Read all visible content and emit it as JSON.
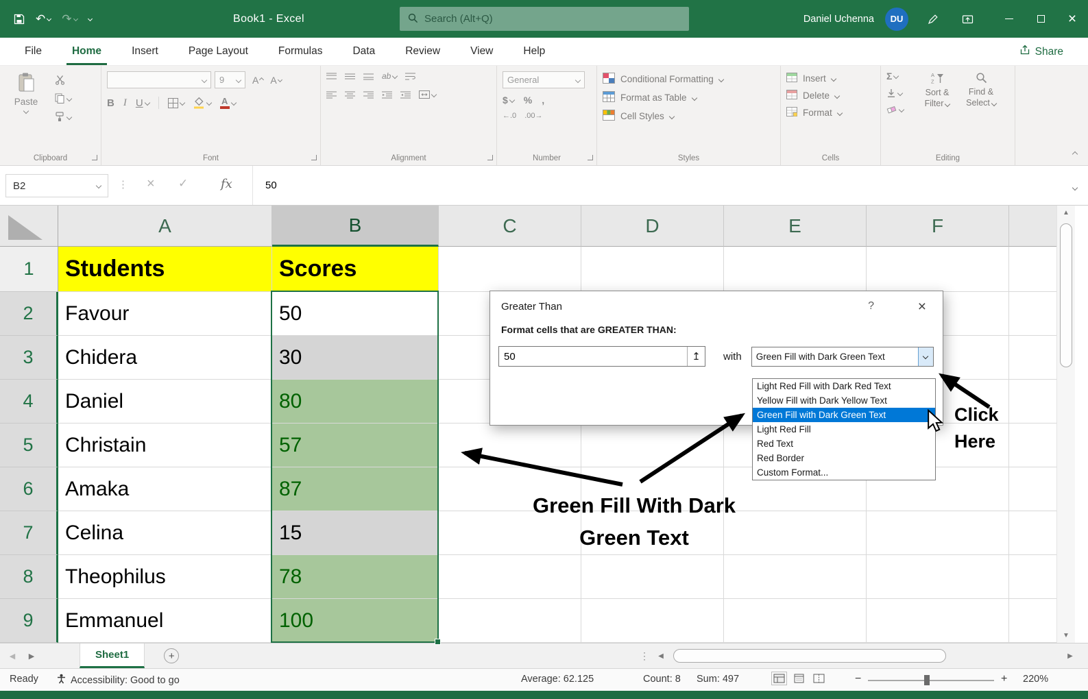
{
  "titlebar": {
    "title": "Book1 - Excel",
    "search_placeholder": "Search (Alt+Q)",
    "user_name": "Daniel Uchenna",
    "user_initials": "DU"
  },
  "menu": {
    "tabs": [
      "File",
      "Home",
      "Insert",
      "Page Layout",
      "Formulas",
      "Data",
      "Review",
      "View",
      "Help"
    ],
    "active_tab": "Home",
    "share_label": "Share"
  },
  "ribbon": {
    "clipboard": {
      "label": "Clipboard",
      "paste": "Paste"
    },
    "font": {
      "label": "Font",
      "size": "9",
      "bold": "B",
      "italic": "I",
      "underline": "U"
    },
    "alignment": {
      "label": "Alignment",
      "orientation": "ab"
    },
    "number": {
      "label": "Number",
      "format": "General",
      "currency": "$",
      "percent": "%",
      "comma": ",",
      "increase_decimal": "←.0",
      "decrease_decimal": ".00→"
    },
    "styles": {
      "label": "Styles",
      "conditional_formatting": "Conditional Formatting",
      "format_as_table": "Format as Table",
      "cell_styles": "Cell Styles"
    },
    "cells": {
      "label": "Cells",
      "insert": "Insert",
      "delete": "Delete",
      "format": "Format"
    },
    "editing": {
      "label": "Editing",
      "autosum": "Σ",
      "sort_line1": "Sort &",
      "sort_line2": "Filter",
      "find_line1": "Find &",
      "find_line2": "Select"
    }
  },
  "formula_bar": {
    "name_box": "B2",
    "fx": "fx",
    "value": "50"
  },
  "grid": {
    "column_headers": [
      "A",
      "B",
      "C",
      "D",
      "E",
      "F"
    ],
    "selected_range_column": "B",
    "rows": [
      {
        "num": "1",
        "student": "Students",
        "score": "Scores"
      },
      {
        "num": "2",
        "student": "Favour",
        "score": "50"
      },
      {
        "num": "3",
        "student": "Chidera",
        "score": "30"
      },
      {
        "num": "4",
        "student": "Daniel",
        "score": "80"
      },
      {
        "num": "5",
        "student": "Christain",
        "score": "57"
      },
      {
        "num": "6",
        "student": "Amaka",
        "score": "87"
      },
      {
        "num": "7",
        "student": "Celina",
        "score": "15"
      },
      {
        "num": "8",
        "student": "Theophilus",
        "score": "78"
      },
      {
        "num": "9",
        "student": "Emmanuel",
        "score": "100"
      }
    ]
  },
  "dialog": {
    "title": "Greater Than",
    "help": "?",
    "prompt": "Format cells that are GREATER THAN:",
    "value": "50",
    "with_label": "with",
    "combo_value": "Green Fill with Dark Green Text",
    "options": [
      "Light Red Fill with Dark Red Text",
      "Yellow Fill with Dark Yellow Text",
      "Green Fill with Dark Green Text",
      "Light Red Fill",
      "Red Text",
      "Red Border",
      "Custom Format..."
    ],
    "selected_option_index": 2
  },
  "annotations": {
    "callout_line1": "Green Fill With Dark",
    "callout_line2": "Green Text",
    "click_line1": "Click",
    "click_line2": "Here"
  },
  "sheet_bar": {
    "tab": "Sheet1",
    "new_sheet": "+"
  },
  "status_bar": {
    "ready": "Ready",
    "accessibility": "Accessibility: Good to go",
    "average": "Average: 62.125",
    "count": "Count: 8",
    "sum": "Sum: 497",
    "zoom_out": "−",
    "zoom_in": "+",
    "zoom_level": "220%"
  },
  "colors": {
    "excel_green": "#217346",
    "header_fill_yellow": "#FFFF00",
    "cf_green_fill": "#A7C79B",
    "cf_dark_green_text": "#006100",
    "selection_gray": "#D5D5D5",
    "listbox_selection_blue": "#0078D7"
  }
}
